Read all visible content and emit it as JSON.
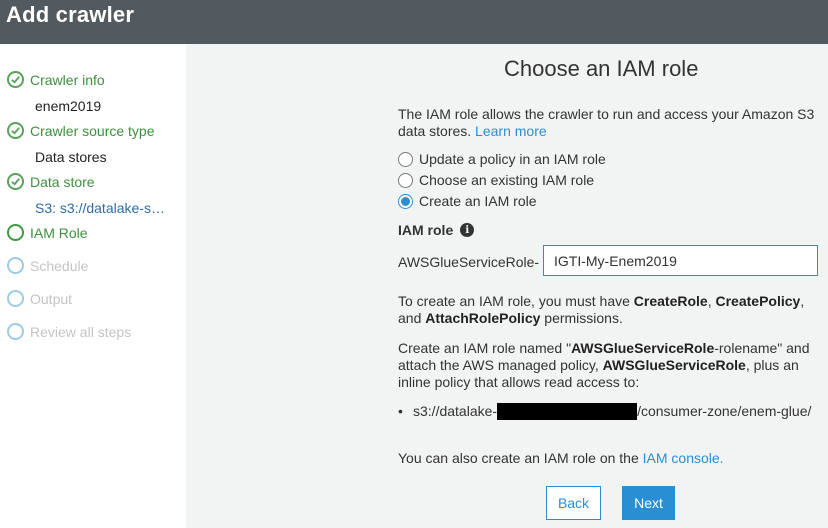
{
  "header": {
    "title": "Add crawler"
  },
  "sidebar": {
    "steps": [
      {
        "label": "Crawler info",
        "detail": "enem2019",
        "state": "done"
      },
      {
        "label": "Crawler source type",
        "detail": "Data stores",
        "state": "done"
      },
      {
        "label": "Data store",
        "detail": "S3: s3://datalake-s…",
        "state": "done"
      },
      {
        "label": "IAM Role",
        "state": "current"
      },
      {
        "label": "Schedule",
        "state": "todo"
      },
      {
        "label": "Output",
        "state": "todo"
      },
      {
        "label": "Review all steps",
        "state": "todo"
      }
    ]
  },
  "main": {
    "title": "Choose an IAM role",
    "description": "The IAM role allows the crawler to run and access your Amazon S3 data stores.",
    "learn_more": "Learn more",
    "options": [
      {
        "label": "Update a policy in an IAM role",
        "checked": false
      },
      {
        "label": "Choose an existing IAM role",
        "checked": false
      },
      {
        "label": "Create an IAM role",
        "checked": true
      }
    ],
    "iam_role_label": "IAM role",
    "role_prefix": "AWSGlueServiceRole-",
    "role_value": "IGTI-My-Enem2019",
    "permissions": {
      "pre": "To create an IAM role, you must have",
      "p1": "CreateRole",
      "sep1": ",",
      "p2": "CreatePolicy",
      "sep2": ", and",
      "p3": "AttachRolePolicy",
      "post": "permissions."
    },
    "create_info": {
      "t1": "Create an IAM role named \"",
      "b1": "AWSGlueServiceRole",
      "t2": "-rolename\" and attach the AWS managed policy,",
      "b2": "AWSGlueServiceRole",
      "t3": ", plus an inline policy that allows read access to:"
    },
    "bullet": "•",
    "s3_prefix": "s3://datalake-",
    "s3_suffix": "/consumer-zone/enem-glue/",
    "console": {
      "text": "You can also create an IAM role on the",
      "link": "IAM console."
    },
    "back_label": "Back",
    "next_label": "Next"
  },
  "colors": {
    "header_bg": "#535a5f",
    "accent": "#2a8ed3",
    "success": "#3f8f3f"
  }
}
